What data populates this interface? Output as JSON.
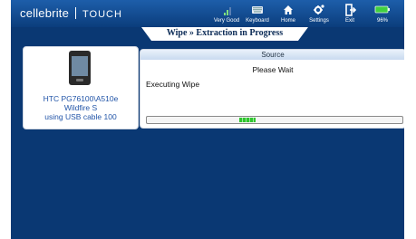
{
  "header": {
    "brand": "cellebrite",
    "product": "TOUCH",
    "items": [
      {
        "label": "Very Good",
        "icon": "signal-icon"
      },
      {
        "label": "Keyboard",
        "icon": "keyboard-icon"
      },
      {
        "label": "Home",
        "icon": "home-icon"
      },
      {
        "label": "Settings",
        "icon": "settings-icon"
      },
      {
        "label": "Exit",
        "icon": "exit-icon"
      },
      {
        "label": "96%",
        "icon": "battery-icon"
      }
    ]
  },
  "title": "Wipe » Extraction in Progress",
  "device": {
    "line1": "HTC PG76100\\A510e",
    "line2": "Wildfire S",
    "line3": "using USB cable 100"
  },
  "source": {
    "header": "Source",
    "message": "Please Wait",
    "status": "Executing Wipe",
    "progress_indeterminate": true
  },
  "colors": {
    "background": "#0a3873",
    "progress": "#2fc62f",
    "device_text": "#2255a8"
  }
}
